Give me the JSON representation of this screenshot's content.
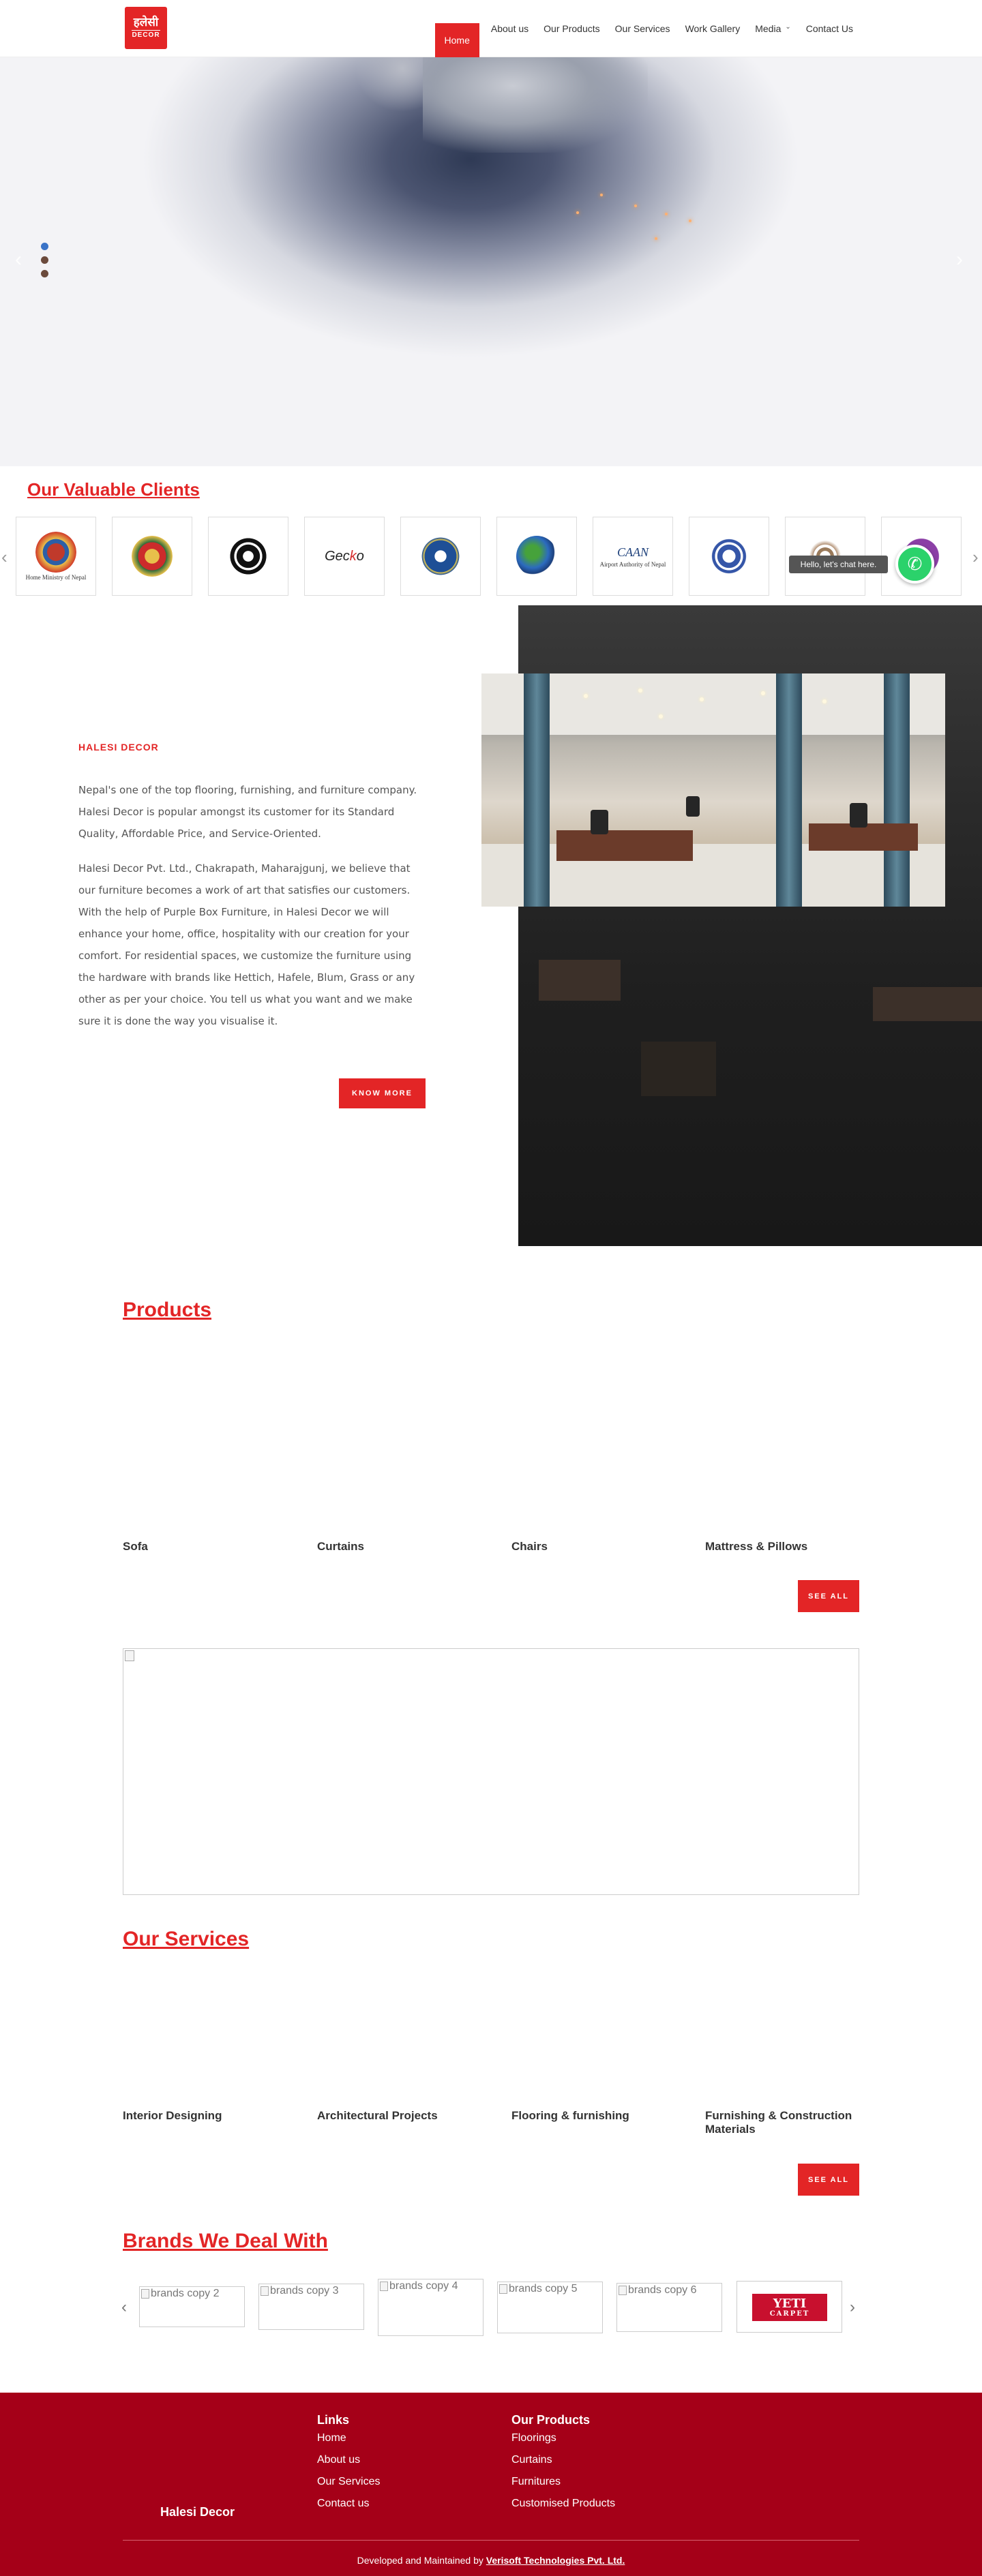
{
  "header": {
    "logo_line1": "हलेसी",
    "logo_line2": "DECOR",
    "nav": [
      {
        "label": "Home"
      },
      {
        "label": "About us"
      },
      {
        "label": "Our Products"
      },
      {
        "label": "Our Services"
      },
      {
        "label": "Work Gallery"
      },
      {
        "label": "Media"
      },
      {
        "label": "Contact Us"
      }
    ],
    "colors": {
      "accent": "#e32526",
      "footer": "#a50018"
    }
  },
  "hero": {
    "slides": 3,
    "active_slide": 1
  },
  "clients": {
    "title": "Our Valuable Clients",
    "items": [
      {
        "caption": "Home Ministry of Nepal",
        "icon": "nepal-emblem-icon"
      },
      {
        "caption": "",
        "icon": "army-emblem-icon"
      },
      {
        "caption": "",
        "icon": "police-emblem-icon"
      },
      {
        "caption": "",
        "icon": "gecko-logo"
      },
      {
        "caption": "",
        "icon": "star-emblem-icon"
      },
      {
        "caption": "",
        "icon": "globe-emblem-icon"
      },
      {
        "caption": "Airport Authority of Nepal",
        "icon": "caan-logo"
      },
      {
        "caption": "",
        "icon": "college-emblem-icon"
      },
      {
        "caption": "",
        "icon": "ornament-emblem-icon"
      },
      {
        "caption": "",
        "icon": "purple-emblem-icon"
      }
    ]
  },
  "chat": {
    "bubble": "Hello, let's chat here."
  },
  "about": {
    "kicker": "HALESI DECOR",
    "para1": "Nepal's one of the top flooring, furnishing, and furniture company. Halesi Decor is popular amongst its customer for its Standard Quality, Affordable Price, and Service-Oriented.",
    "para2": "Halesi Decor Pvt. Ltd., Chakrapath, Maharajgunj, we believe that our furniture becomes a work of art that satisfies our customers. With the help of Purple Box Furniture, in Halesi Decor we will enhance your home, office, hospitality with our creation for your comfort. For residential spaces, we customize the furniture using the hardware with brands like Hettich, Hafele, Blum, Grass or any other as per your choice. You tell us what you want and we make sure it is done the way you visualise it.",
    "button": "KNOW MORE"
  },
  "products": {
    "title": "Products",
    "items": [
      "Sofa",
      "Curtains",
      "Chairs",
      "Mattress & Pillows"
    ],
    "button": "SEE ALL"
  },
  "services": {
    "title": "Our Services",
    "items": [
      "Interior Designing",
      "Architectural Projects",
      "Flooring & furnishing",
      "Furnishing & Construction Materials"
    ],
    "button": "SEE ALL"
  },
  "brands": {
    "title": "Brands We Deal With",
    "items": [
      {
        "alt": "brands copy 2"
      },
      {
        "alt": "brands copy 3"
      },
      {
        "alt": "brands copy 4"
      },
      {
        "alt": "brands copy 5"
      },
      {
        "alt": "brands copy 6"
      },
      {
        "logo_line1": "YETI",
        "logo_line2": "CARPET"
      }
    ]
  },
  "footer": {
    "brand": "Halesi Decor",
    "links_title": "Links",
    "links": [
      "Home",
      "About us",
      "Our Services",
      "Contact us"
    ],
    "products_title": "Our Products",
    "products": [
      "Floorings",
      "Curtains",
      "Furnitures",
      "Customised Products"
    ],
    "credit_prefix": "Developed and Maintained by ",
    "credit_link": "Verisoft Technologies Pvt. Ltd."
  }
}
